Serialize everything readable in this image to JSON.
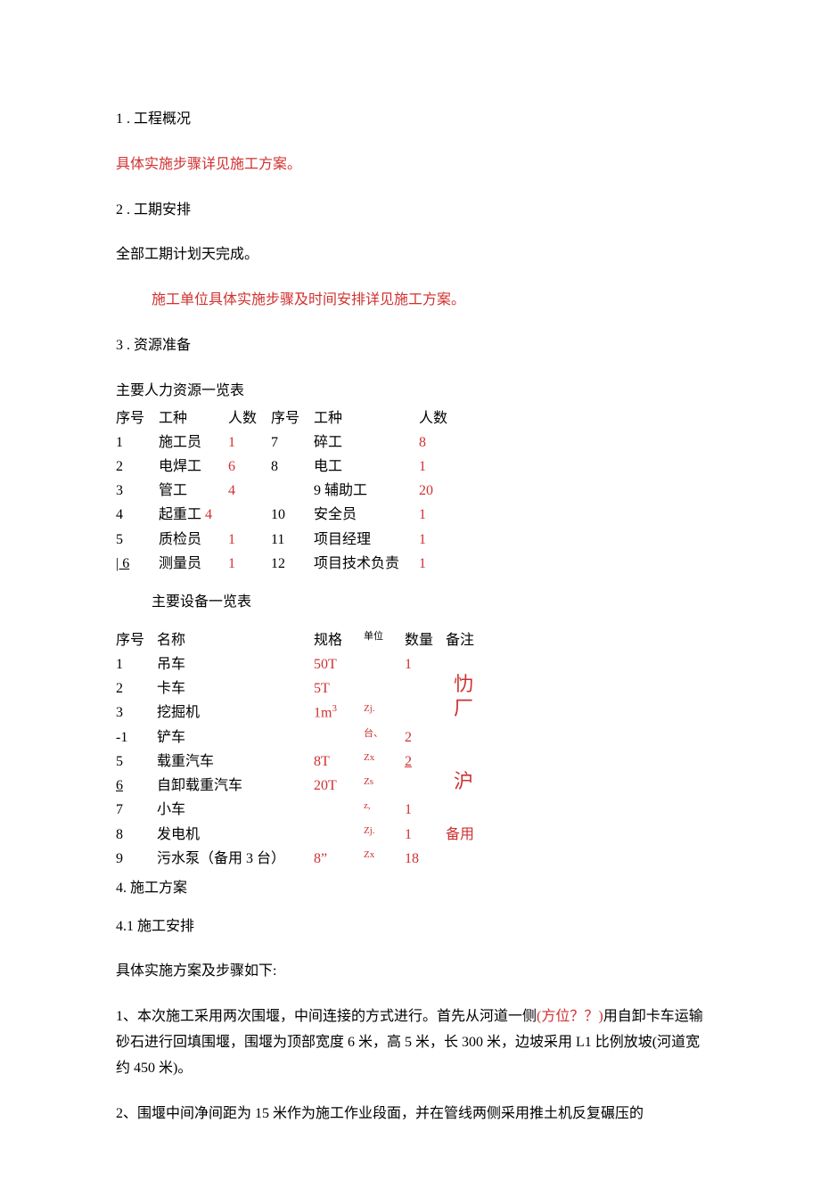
{
  "section1": {
    "heading": "1 . 工程概况",
    "note": "具体实施步骤详见施工方案。"
  },
  "section2": {
    "heading": "2 . 工期安排",
    "body": "全部工期计划天完成。",
    "note": "施工单位具体实施步骤及时间安排详见施工方案。"
  },
  "section3": {
    "heading": "3 . 资源准备",
    "table1_title": "主要人力资源一览表",
    "table1_headers": {
      "seq_a": "序号",
      "role_a": "工种",
      "count_a": "人数",
      "seq_b": "序号",
      "role_b": "工种",
      "count_b": "人数"
    },
    "table1_rows": [
      {
        "a_seq": "1",
        "a_role": "施工员",
        "a_cnt": "1",
        "b_seq": "7",
        "b_role": "碎工",
        "b_cnt": "8"
      },
      {
        "a_seq": "2",
        "a_role": "电焊工",
        "a_cnt": "6",
        "b_seq": "8",
        "b_role": "电工",
        "b_cnt": "1"
      },
      {
        "a_seq": "3",
        "a_role": "管工",
        "a_cnt": "4",
        "b_seq": "9",
        "b_role": "辅助工",
        "b_cnt": "20",
        "prefix_b": true
      },
      {
        "a_seq": "4",
        "a_role": "起重工",
        "a_cnt": "4",
        "b_seq": "10",
        "b_role": "安全员",
        "b_cnt": "1",
        "cnt_after_role_a": true
      },
      {
        "a_seq": "5",
        "a_role": "质检员",
        "a_cnt": "1",
        "b_seq": "11",
        "b_role": "项目经理",
        "b_cnt": "1"
      },
      {
        "a_seq": "| 6",
        "a_role": "测量员",
        "a_cnt": "1",
        "b_seq": "12",
        "b_role": "项目技术负责",
        "b_cnt": "1",
        "ul_a": true
      }
    ],
    "table2_title": "主要设备一览表",
    "table2_headers": {
      "seq": "序号",
      "name": "名称",
      "spec": "规格",
      "unit": "单位",
      "qty": "数量",
      "note": "备注"
    },
    "table2_rows": [
      {
        "seq": "1",
        "name": "吊车",
        "spec": "50T",
        "unit": "",
        "qty": "1",
        "note": ""
      },
      {
        "seq": "2",
        "name": "卡车",
        "spec": "5T",
        "unit": "",
        "qty": "",
        "note": "",
        "glyph": "忇",
        "gx": 55,
        "gy": -2
      },
      {
        "seq": "3",
        "name": "挖掘机",
        "spec": "1m³",
        "unit": "Zj.",
        "qty": "",
        "note": "",
        "sup_spec": true,
        "glyph": "厂",
        "gx": 55,
        "gy": -2
      },
      {
        "seq": "-1",
        "name": "铲车",
        "spec": "",
        "unit": "台、",
        "qty": "2",
        "note": ""
      },
      {
        "seq": "5",
        "name": "载重汽车",
        "spec": "8T",
        "unit": "Zx",
        "qty": "2",
        "note": "",
        "ul_qty": true
      },
      {
        "seq": "6",
        "name": "自卸载重汽车",
        "spec": "20T",
        "unit": "Zs",
        "qty": "",
        "note": "",
        "ul_seq": true,
        "glyph": "沪",
        "gx": 55,
        "gy": -2
      },
      {
        "seq": "7",
        "name": "小车",
        "spec": "",
        "unit": "z,",
        "qty": "1",
        "note": ""
      },
      {
        "seq": "8",
        "name": "发电机",
        "spec": "",
        "unit": "Zj.",
        "qty": "1",
        "note": "备用"
      },
      {
        "seq": "9",
        "name": "污水泵（备用 3 台）",
        "spec": "8”",
        "unit": "Zx",
        "qty": "18",
        "note": ""
      }
    ]
  },
  "section4": {
    "heading": "4. 施工方案",
    "sub_heading": "4.1 施工安排",
    "intro": "具体实施方案及步骤如下:",
    "para1_a": "1、本次施工采用两次围堰，中间连接的方式进行。首先从河道一侧",
    "para1_red": "(方位？？)",
    "para1_b": "用自卸卡车运输砂石进行回填围堰，围堰为顶部宽度 6 米，高 5 米，长 300 米，边坡采用 L1 比例放坡(河道宽约 450 米)。",
    "para2": "2、围堰中间净间距为 15 米作为施工作业段面，并在管线两侧采用推土机反复碾压的"
  }
}
